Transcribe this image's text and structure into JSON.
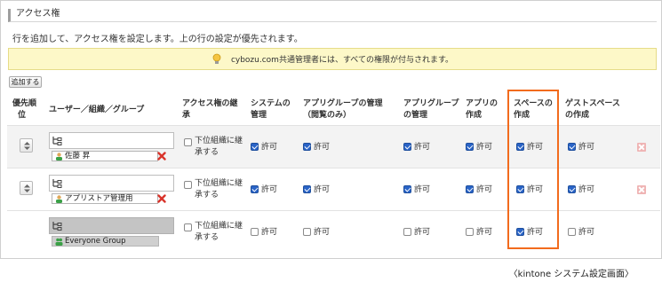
{
  "section": {
    "title": "アクセス権"
  },
  "description": "行を追加して、アクセス権を設定します。上の行の設定が優先されます。",
  "notice": {
    "text": "cybozu.com共通管理者には、すべての権限が付与されます。",
    "icon": "lightbulb-icon"
  },
  "toolbar": {
    "add_label": "追加する"
  },
  "table": {
    "headers": {
      "priority": [
        "優先順",
        "位"
      ],
      "user": "ユーザー／組織／グループ",
      "inherit": [
        "アクセス権の継",
        "承"
      ],
      "system_admin": [
        "システムの",
        "管理"
      ],
      "appgroup_admin": [
        "アプリグループの管理",
        "（閲覧のみ）"
      ],
      "appgroup_mgmt": [
        "アプリグループ",
        "の管理"
      ],
      "app_create": [
        "アプリの",
        "作成"
      ],
      "space_create": [
        "スペースの",
        "作成"
      ],
      "guest_space_create": [
        "ゲストスペース",
        "の作成"
      ]
    },
    "allow_label": "許可",
    "inherit_label": [
      "下位組織に継",
      "承する"
    ],
    "rows": [
      {
        "entity": "佐藤 昇",
        "entity_type": "user",
        "removable": true,
        "inherit": false,
        "system_admin": true,
        "appgroup_admin": true,
        "appgroup_mgmt": true,
        "app_create": true,
        "space_create": true,
        "guest_space_create": true
      },
      {
        "entity": "アプリストア管理用",
        "entity_type": "user",
        "removable": true,
        "inherit": false,
        "system_admin": true,
        "appgroup_admin": true,
        "appgroup_mgmt": true,
        "app_create": true,
        "space_create": true,
        "guest_space_create": true
      },
      {
        "entity": "Everyone Group",
        "entity_type": "group",
        "removable": false,
        "inherit": false,
        "system_admin": false,
        "appgroup_admin": false,
        "appgroup_mgmt": false,
        "app_create": false,
        "space_create": true,
        "guest_space_create": false
      }
    ]
  },
  "caption": "〈kintone システム設定画面〉",
  "colors": {
    "highlight": "#f26b1d",
    "checkbox_on": "#2a64c7",
    "notice_bg": "#fdf8c8",
    "delete": "#e05050"
  }
}
